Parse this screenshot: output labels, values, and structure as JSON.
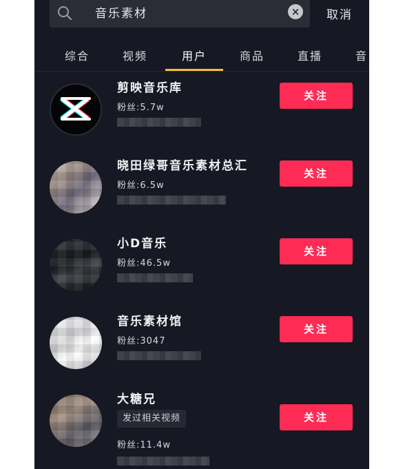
{
  "search": {
    "query": "音乐素材",
    "clear_symbol": "×",
    "cancel_label": "取消"
  },
  "tabs": [
    {
      "label": "综合"
    },
    {
      "label": "视频"
    },
    {
      "label": "用户",
      "active": true
    },
    {
      "label": "商品"
    },
    {
      "label": "直播"
    },
    {
      "label": "音"
    }
  ],
  "results": [
    {
      "name": "剪映音乐库",
      "fans": "粉丝:5.7w",
      "follow_label": "关注"
    },
    {
      "name": "晓田绿哥音乐素材总汇",
      "fans": "粉丝:6.5w",
      "follow_label": "关注"
    },
    {
      "name": "小D音乐",
      "fans": "粉丝:46.5w",
      "follow_label": "关注"
    },
    {
      "name": "音乐素材馆",
      "fans": "粉丝:3047",
      "follow_label": "关注"
    },
    {
      "name": "大糖兄",
      "tag": "发过相关视频",
      "fans": "粉丝:11.4w",
      "follow_label": "关注"
    }
  ],
  "colors": {
    "background": "#161823",
    "follow_button": "#fe2c55",
    "tab_indicator": "#f7c136"
  }
}
